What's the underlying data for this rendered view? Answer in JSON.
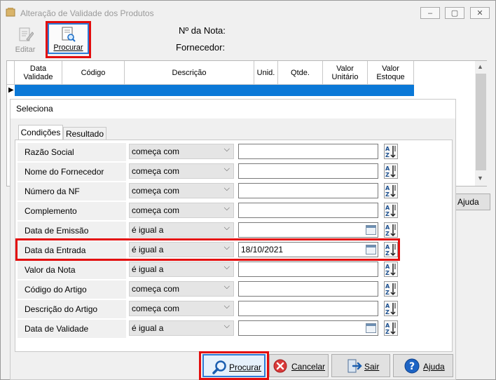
{
  "window": {
    "title": "Alteração de Validade dos Produtos",
    "minimize_glyph": "–",
    "maximize_glyph": "▢",
    "close_glyph": "✕"
  },
  "toolbar": {
    "edit_label": "Editar",
    "search_label": "Procurar"
  },
  "header": {
    "nota_label": "Nº da Nota:",
    "fornecedor_label": "Fornecedor:"
  },
  "grid": {
    "columns": [
      "Data Validade",
      "Código",
      "Descrição",
      "Unid.",
      "Qtde.",
      "Valor Unitário",
      "Valor Estoque"
    ],
    "row_indicator": "▶"
  },
  "background_help_label": "Ajuda",
  "dialog": {
    "title": "Seleciona",
    "tabs": [
      "Condições",
      "Resultado"
    ],
    "conditions": [
      {
        "label": "Razão Social",
        "operator": "começa com",
        "value": "",
        "date": false
      },
      {
        "label": "Nome do Fornecedor",
        "operator": "começa com",
        "value": "",
        "date": false
      },
      {
        "label": "Número da NF",
        "operator": "começa com",
        "value": "",
        "date": false
      },
      {
        "label": "Complemento",
        "operator": "começa com",
        "value": "",
        "date": false
      },
      {
        "label": "Data de Emissão",
        "operator": "é igual a",
        "value": "",
        "date": true
      },
      {
        "label": "Data da Entrada",
        "operator": "é igual a",
        "value": "18/10/2021",
        "date": true
      },
      {
        "label": "Valor da Nota",
        "operator": "é igual a",
        "value": "",
        "date": false
      },
      {
        "label": "Código do Artigo",
        "operator": "começa com",
        "value": "",
        "date": false
      },
      {
        "label": "Descrição do Artigo",
        "operator": "começa com",
        "value": "",
        "date": false
      },
      {
        "label": "Data de Validade",
        "operator": "é igual a",
        "value": "",
        "date": true
      }
    ],
    "buttons": {
      "procurar": "Procurar",
      "cancelar": "Cancelar",
      "sair": "Sair",
      "ajuda": "Ajuda"
    }
  },
  "colors": {
    "selection_blue": "#0a78d7",
    "highlight_red": "#e30d0d",
    "focus_blue": "#2c7bd6"
  }
}
